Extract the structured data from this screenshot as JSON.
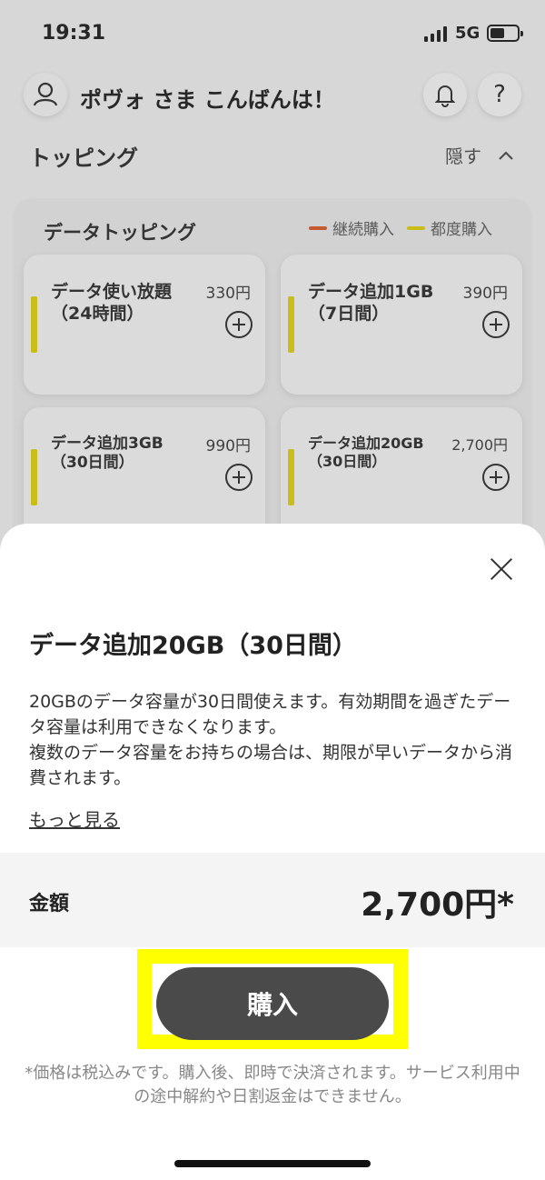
{
  "status_bar": {
    "time": "19:31",
    "network": "5G"
  },
  "header": {
    "greeting": "ポヴォ さま こんばんは！",
    "help_label": "?"
  },
  "section": {
    "title": "トッピング",
    "hide_label": "隠す"
  },
  "panel": {
    "title": "データトッピング",
    "legend": [
      {
        "label": "継続購入",
        "color": "#d9531e"
      },
      {
        "label": "都度購入",
        "color": "#e0d100"
      }
    ],
    "cards": [
      {
        "name": "データ使い放題（24時間）",
        "price": "330円"
      },
      {
        "name": "データ追加1GB（7日間）",
        "price": "390円"
      },
      {
        "name": "データ追加3GB（30日間）",
        "price": "990円"
      },
      {
        "name": "データ追加20GB（30日間）",
        "price": "2,700円"
      }
    ]
  },
  "sheet": {
    "title": "データ追加20GB（30日間）",
    "description": "20GBのデータ容量が30日間使えます。有効期間を過ぎたデータ容量は利用できなくなります。\n複数のデータ容量をお持ちの場合は、期限が早いデータから消費されます。",
    "more_link": "もっと見る",
    "price_label": "金額",
    "price_value": "2,700円*",
    "buy_button": "購入",
    "note": "*価格は税込みです。購入後、即時で決済されます。サービス利用中の途中解約や日割返金はできません。"
  },
  "colors": {
    "highlight": "#ffff00",
    "button": "#4a4a4a"
  }
}
